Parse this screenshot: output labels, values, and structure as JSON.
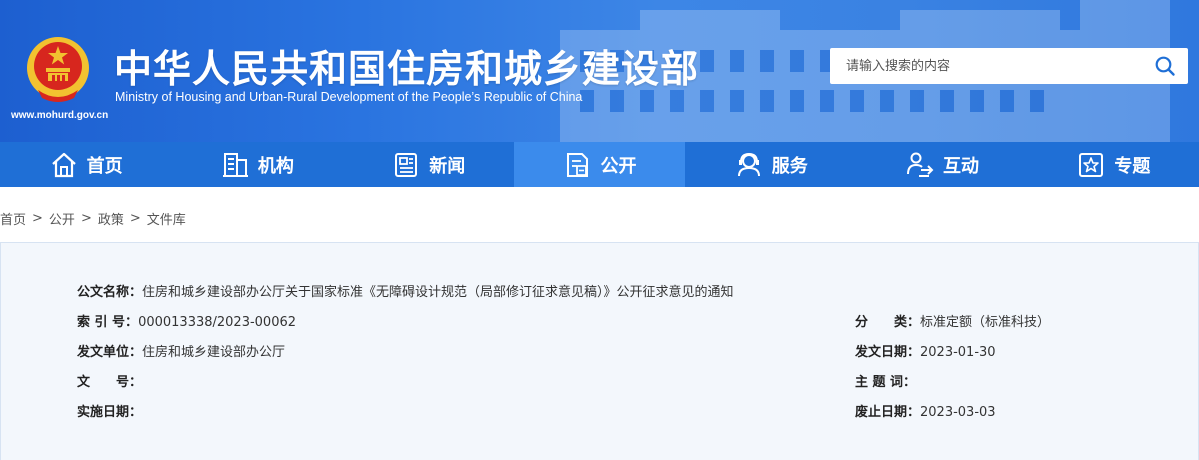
{
  "header": {
    "site_url": "www.mohurd.gov.cn",
    "title_cn": "中华人民共和国住房和城乡建设部",
    "title_en": "Ministry of Housing and Urban-Rural Development of the People’s Republic of China",
    "emblem_icon": "national-emblem-icon",
    "search": {
      "placeholder": "请输入搜索的内容",
      "icon": "search-icon"
    }
  },
  "nav": {
    "items": [
      {
        "label": "首页",
        "icon": "home-icon"
      },
      {
        "label": "机构",
        "icon": "building-icon"
      },
      {
        "label": "新闻",
        "icon": "news-icon"
      },
      {
        "label": "公开",
        "icon": "public-icon",
        "active": true
      },
      {
        "label": "服务",
        "icon": "service-icon"
      },
      {
        "label": "互动",
        "icon": "interaction-icon"
      },
      {
        "label": "专题",
        "icon": "star-topic-icon"
      }
    ]
  },
  "breadcrumb": [
    "首页",
    "公开",
    "政策",
    "文件库"
  ],
  "doc_info": {
    "name_label": "公文名称：",
    "name_value": "住房和城乡建设部办公厅关于国家标准《无障碍设计规范（局部修订征求意见稿）》公开征求意见的通知",
    "index_label": "索 引 号：",
    "index_value": "000013338/2023-00062",
    "category_label": "分　　类：",
    "category_value": "标准定额（标准科技）",
    "issuer_label": "发文单位：",
    "issuer_value": "住房和城乡建设部办公厅",
    "date_label": "发文日期：",
    "date_value": "2023-01-30",
    "docno_label": "文　　号：",
    "docno_value": "",
    "subject_label": "主 题 词：",
    "subject_value": "",
    "effective_label": "实施日期：",
    "effective_value": "",
    "expiry_label": "废止日期：",
    "expiry_value": "2023-03-03"
  },
  "colors": {
    "nav_bg": "#1f6fd6",
    "nav_active": "#3b8bec",
    "header_blue": "#2a74e0",
    "panel_bg": "#f3f7fc"
  }
}
